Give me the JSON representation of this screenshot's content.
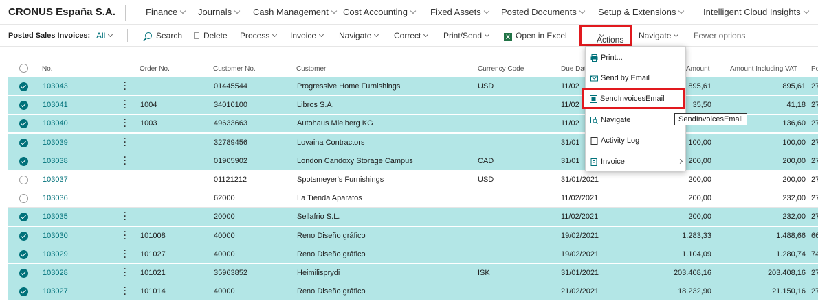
{
  "app": {
    "company": "CRONUS España S.A."
  },
  "topnav": {
    "items": [
      "Finance",
      "Journals",
      "Cash Management",
      "Cost Accounting",
      "Fixed Assets",
      "Posted Documents",
      "Setup & Extensions",
      "Intelligent Cloud Insights"
    ]
  },
  "actionbar": {
    "page_label": "Posted Sales Invoices:",
    "filter": "All",
    "search": "Search",
    "delete": "Delete",
    "process": "Process",
    "invoice": "Invoice",
    "navigate": "Navigate",
    "correct": "Correct",
    "print_send": "Print/Send",
    "open_excel": "Open in Excel",
    "actions": "Actions",
    "navigate2": "Navigate",
    "fewer": "Fewer options"
  },
  "columns": [
    "No.",
    "Order No.",
    "Customer No.",
    "Customer",
    "Currency Code",
    "Due Dat",
    "Amount",
    "Amount Including VAT",
    "Po"
  ],
  "rows": [
    {
      "selected": true,
      "no": "103043",
      "order": "",
      "cust_no": "01445544",
      "customer": "Progressive Home Furnishings",
      "currency": "USD",
      "due": "11/02",
      "amount": "895,61",
      "amount_vat": "895,61"
    },
    {
      "selected": true,
      "no": "103041",
      "order": "1004",
      "cust_no": "34010100",
      "customer": "Libros S.A.",
      "currency": "",
      "due": "11/02",
      "amount": "35,50",
      "amount_vat": "41,18"
    },
    {
      "selected": true,
      "no": "103040",
      "order": "1003",
      "cust_no": "49633663",
      "customer": "Autohaus Mielberg KG",
      "currency": "",
      "due": "11/02",
      "amount": "",
      "amount_vat": "136,60"
    },
    {
      "selected": true,
      "no": "103039",
      "order": "",
      "cust_no": "32789456",
      "customer": "Lovaina Contractors",
      "currency": "",
      "due": "31/01",
      "amount": "100,00",
      "amount_vat": "100,00"
    },
    {
      "selected": true,
      "no": "103038",
      "order": "",
      "cust_no": "01905902",
      "customer": "London Candoxy Storage Campus",
      "currency": "CAD",
      "due": "31/01",
      "amount": "200,00",
      "amount_vat": "200,00"
    },
    {
      "selected": false,
      "no": "103037",
      "order": "",
      "cust_no": "01121212",
      "customer": "Spotsmeyer's Furnishings",
      "currency": "USD",
      "due": "31/01/2021",
      "amount": "200,00",
      "amount_vat": "200,00"
    },
    {
      "selected": false,
      "no": "103036",
      "order": "",
      "cust_no": "62000",
      "customer": "La Tienda Aparatos",
      "currency": "",
      "due": "11/02/2021",
      "amount": "200,00",
      "amount_vat": "232,00"
    },
    {
      "selected": true,
      "no": "103035",
      "order": "",
      "cust_no": "20000",
      "customer": "Sellafrio S.L.",
      "currency": "",
      "due": "11/02/2021",
      "amount": "200,00",
      "amount_vat": "232,00"
    },
    {
      "selected": true,
      "no": "103030",
      "order": "101008",
      "cust_no": "40000",
      "customer": "Reno Diseño gráfico",
      "currency": "",
      "due": "19/02/2021",
      "amount": "1.283,33",
      "amount_vat": "1.488,66"
    },
    {
      "selected": true,
      "no": "103029",
      "order": "101027",
      "cust_no": "40000",
      "customer": "Reno Diseño gráfico",
      "currency": "",
      "due": "19/02/2021",
      "amount": "1.104,09",
      "amount_vat": "1.280,74"
    },
    {
      "selected": true,
      "no": "103028",
      "order": "101021",
      "cust_no": "35963852",
      "customer": "Heimilisprydi",
      "currency": "ISK",
      "due": "31/01/2021",
      "amount": "203.408,16",
      "amount_vat": "203.408,16"
    },
    {
      "selected": true,
      "no": "103027",
      "order": "101014",
      "cust_no": "40000",
      "customer": "Reno Diseño gráfico",
      "currency": "",
      "due": "21/02/2021",
      "amount": "18.232,90",
      "amount_vat": "21.150,16"
    }
  ],
  "row_tails": [
    "27",
    "27",
    "27",
    "27",
    "27",
    "27",
    "27",
    "27",
    "66",
    "74",
    "27",
    "27"
  ],
  "menu": {
    "items": [
      "Print...",
      "Send by Email",
      "SendInvoicesEmail",
      "Navigate",
      "Activity Log",
      "Invoice"
    ]
  },
  "tooltip": "SendInvoicesEmail",
  "colors": {
    "accent": "#00717a",
    "selected_row": "#b3e6e6",
    "highlight": "#e1191e"
  }
}
